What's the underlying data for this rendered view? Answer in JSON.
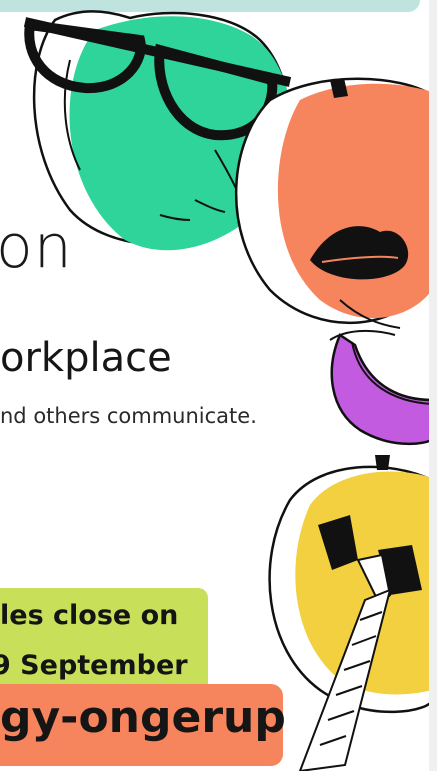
{
  "poster": {
    "title_fragment": "on",
    "heading_fragment": "orkplace",
    "body_fragment": "nd others communicate.",
    "deadline_line1": "les close on",
    "deadline_line2": "9 September",
    "code_fragment": "gy-ongerup"
  },
  "colors": {
    "teal": "#bfe3df",
    "green": "#2fd49a",
    "orange": "#f6845d",
    "purple": "#c25bdf",
    "yellow": "#f2d040",
    "lime": "#c8df5a"
  },
  "icons": [
    "apple-with-glasses-icon",
    "peach-with-lips-icon",
    "purple-fruit-slice-icon",
    "lemon-with-bowtie-icon"
  ]
}
